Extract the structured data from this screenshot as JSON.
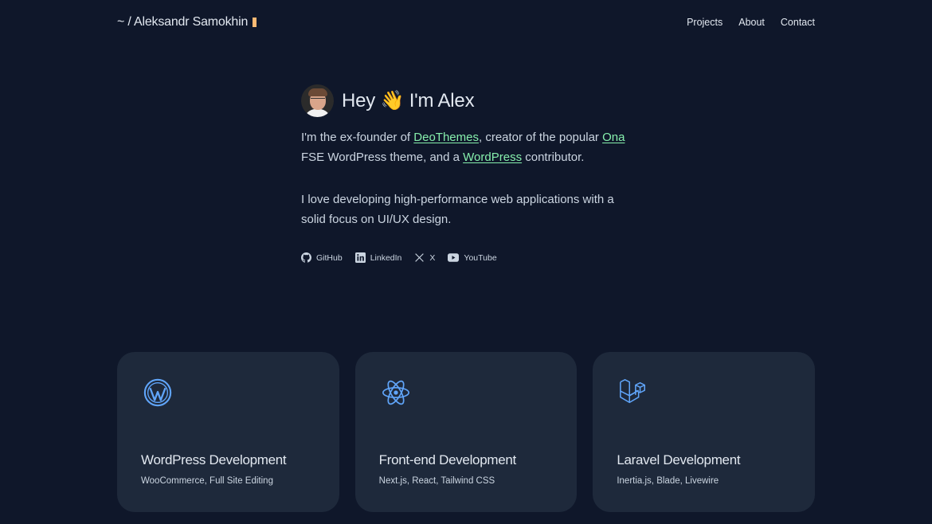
{
  "header": {
    "brand": "~ / Aleksandr Samokhin",
    "nav": [
      "Projects",
      "About",
      "Contact"
    ]
  },
  "hero": {
    "title": "Hey 👋 I'm Alex",
    "intro": {
      "t1": "I'm the ex-founder of ",
      "link1": "DeoThemes",
      "t2": ", creator of the popular ",
      "link2": "Ona",
      "t3": " FSE WordPress theme, and a ",
      "link3": "WordPress",
      "t4": " contributor."
    },
    "bio": "I love developing high-performance web applications with a solid focus on UI/UX design.",
    "socials": [
      {
        "label": "GitHub",
        "icon": "github-icon"
      },
      {
        "label": "LinkedIn",
        "icon": "linkedin-icon"
      },
      {
        "label": "X",
        "icon": "x-icon"
      },
      {
        "label": "YouTube",
        "icon": "youtube-icon"
      }
    ]
  },
  "cards": [
    {
      "title": "WordPress Development",
      "subtitle": "WooCommerce, Full Site Editing",
      "icon": "wordpress-icon"
    },
    {
      "title": "Front-end Development",
      "subtitle": "Next.js, React, Tailwind CSS",
      "icon": "react-icon"
    },
    {
      "title": "Laravel Development",
      "subtitle": "Inertia.js, Blade, Livewire",
      "icon": "laravel-icon"
    }
  ],
  "colors": {
    "background": "#0f172a",
    "card": "#1e293b",
    "link": "#86efac",
    "cursor": "#fdba74",
    "icon": "#60a5fa"
  }
}
